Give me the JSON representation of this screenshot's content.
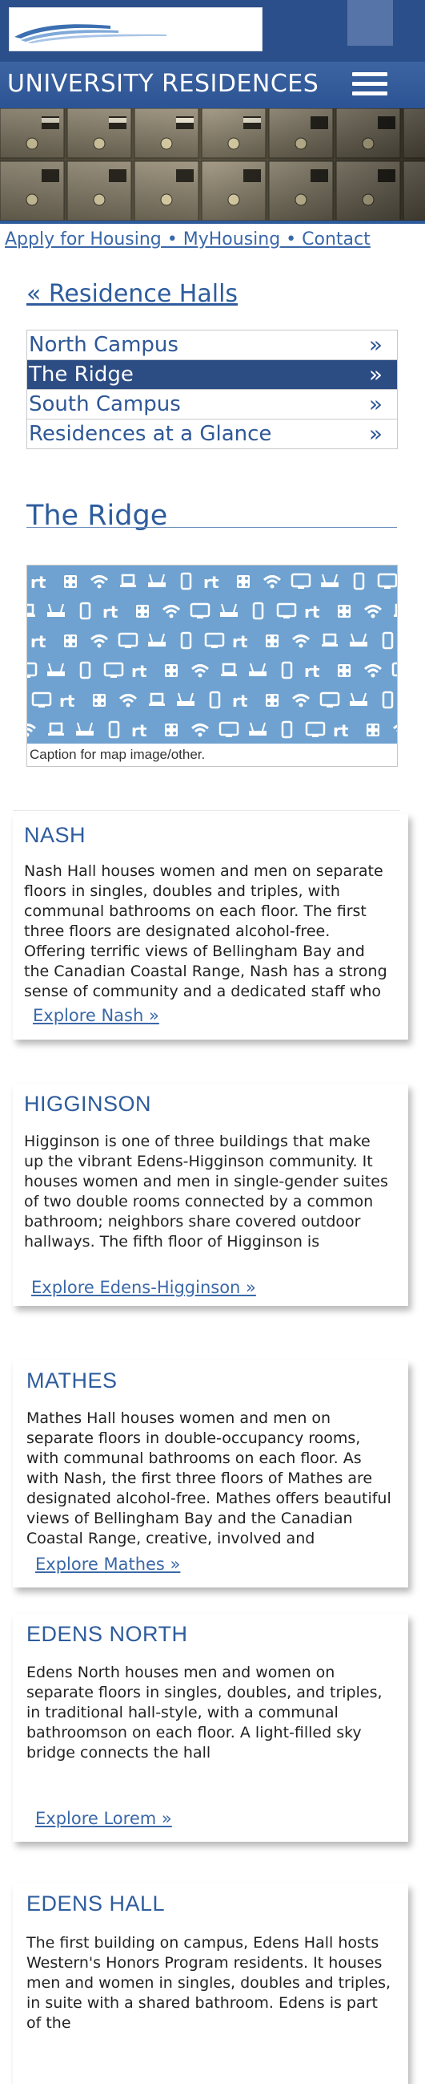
{
  "header": {
    "site_title": "UNIVERSITY RESIDENCES",
    "logo_icon": "wwu-wave-logo",
    "menu_icon": "hamburger-menu-icon",
    "brand_color": "#2b4f8a"
  },
  "hero": {
    "image": "mailboxes-photo"
  },
  "quicklinks": {
    "items": [
      "Apply for Housing",
      "MyHousing",
      "Contact"
    ],
    "separator": " • "
  },
  "breadcrumb": {
    "label": "« Residence Halls"
  },
  "hall_nav": {
    "items": [
      {
        "label": "North Campus",
        "chevron": "»",
        "active": false
      },
      {
        "label": "The Ridge",
        "chevron": "»",
        "active": true
      },
      {
        "label": "South Campus",
        "chevron": "»",
        "active": false
      },
      {
        "label": "Residences at a Glance",
        "chevron": "»",
        "active": false
      }
    ]
  },
  "section": {
    "title": "The Ridge"
  },
  "map": {
    "caption": "Caption for map image/other."
  },
  "cards": [
    {
      "title": "NASH",
      "body": "Nash Hall houses women and men on separate floors in singles, doubles and triples, with communal bathrooms on each floor. The first three floors are designated alcohol-free. Offering terrific views of Bellingham Bay and the Canadian Coastal Range, Nash has a strong sense of community and a dedicated staff who facilitate an",
      "link": "Explore Nash »"
    },
    {
      "title": "HIGGINSON",
      "body": "Higginson is one of three buildings that make up the vibrant Edens-Higginson community. It houses women and men in single-gender suites of two double rooms connected by a common bathroom; neighbors share covered outdoor hallways. The fifth floor of Higginson is designated as substance-free The Edens-Higginson",
      "link": "Explore Edens-Higginson »"
    },
    {
      "title": "MATHES",
      "body": "Mathes Hall houses women and men on separate floors in double-occupancy rooms, with communal bathrooms on each floor. As with Nash, the first three floors of Mathes are designated alcohol-free. Mathes offers beautiful views of Bellingham Bay and the Canadian Coastal Range, creative, involved and welcoming residents, an",
      "link": "Explore Mathes »"
    },
    {
      "title": "EDENS NORTH",
      "body": "Edens North houses men and women on separate floors in singles, doubles, and triples, in traditional hall-style, with a communal bathroomson on each floor. A light-filled sky bridge connects the hall",
      "link": "Explore Lorem »"
    },
    {
      "title": "EDENS HALL",
      "body": "The first building on campus, Edens Hall hosts Western's Honors Program residents. It houses men and women in singles, doubles and triples, in suite with a shared bathroom. Edens is part of the",
      "link": ""
    }
  ]
}
